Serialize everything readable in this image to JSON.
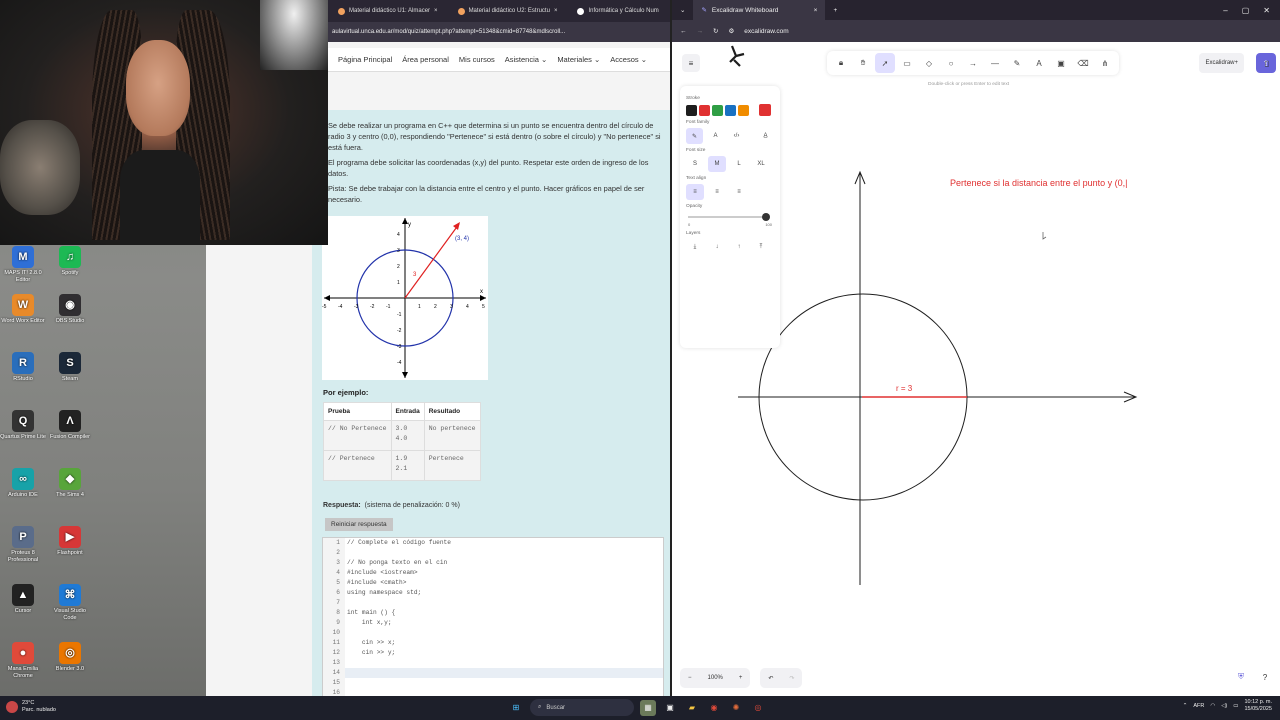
{
  "desktop": {
    "icons": [
      {
        "label": "MAPS IT! 2.8.0 Editor",
        "color": "#2f6fd6",
        "glyph": "M"
      },
      {
        "label": "Spotify",
        "color": "#1db954",
        "glyph": "♫"
      },
      {
        "label": "Word Worx Editor",
        "color": "#e88a2a",
        "glyph": "W"
      },
      {
        "label": "OBS Studio",
        "color": "#302e31",
        "glyph": "◉"
      },
      {
        "label": "RStudio",
        "color": "#2a6ebb",
        "glyph": "R"
      },
      {
        "label": "Steam",
        "color": "#1b2838",
        "glyph": "S"
      },
      {
        "label": "Quartus Prime Lite",
        "color": "#333333",
        "glyph": "Q"
      },
      {
        "label": "Fusion Compiler",
        "color": "#222222",
        "glyph": "Λ"
      },
      {
        "label": "Arduino IDE",
        "color": "#17a2a8",
        "glyph": "∞"
      },
      {
        "label": "The Sims 4",
        "color": "#58a53b",
        "glyph": "◆"
      },
      {
        "label": "Proteus 8 Professional",
        "color": "#5a6c8a",
        "glyph": "P"
      },
      {
        "label": "Flashpoint",
        "color": "#d63737",
        "glyph": "▶"
      },
      {
        "label": "Cursor",
        "color": "#222222",
        "glyph": "▲"
      },
      {
        "label": "Visual Studio Code",
        "color": "#1f7ad6",
        "glyph": "⌘"
      },
      {
        "label": "Mana Emilia Chrome",
        "color": "#e04a3a",
        "glyph": "●"
      },
      {
        "label": "Blender 3.0",
        "color": "#ea7600",
        "glyph": "◎"
      }
    ]
  },
  "left_browser": {
    "tabs": [
      "Material didáctico U1: Almacer",
      "Material didáctico U2: Estructu",
      "Informática y Cálculo Num"
    ],
    "url": "aulavirtual.unca.edu.ar/mod/quiz/attempt.php?attempt=51348&cmid=87748&mdlscroll...",
    "nav": [
      "Página Principal",
      "Área personal",
      "Mis cursos",
      "Asistencia ⌄",
      "Materiales ⌄",
      "Accesos ⌄"
    ],
    "desc": [
      "Se debe realizar un programa en C++ que determina si un punto se encuentra dentro del círculo de radio 3 y centro (0,0), respondiendo \"Pertenece\" si está dentro (o sobre el círculo) y \"No pertenece\" si está fuera.",
      "El programa debe solicitar las coordenadas (x,y) del punto. Respetar este orden de ingreso de los datos.",
      "Pista: Se debe trabajar con la distancia entre el centro y el punto. Hacer gráficos en papel de ser necesario."
    ],
    "plot": {
      "point_label": "(3, 4)",
      "radius_label": "3",
      "x_axis": "x",
      "y_axis": "y",
      "x_ticks": [
        "-5",
        "-4",
        "-3",
        "-2",
        "-1",
        "1",
        "2",
        "3",
        "4",
        "5"
      ],
      "y_ticks": [
        "4",
        "3",
        "2",
        "1",
        "-1",
        "-2",
        "-3",
        "-4"
      ]
    },
    "example_label": "Por ejemplo:",
    "table": {
      "headers": [
        "Prueba",
        "Entrada",
        "Resultado"
      ],
      "rows": [
        [
          "// No Pertenece",
          "3.0\n4.0",
          "No pertenece"
        ],
        [
          "// Pertenece",
          "1.9\n2.1",
          "Pertenece"
        ]
      ]
    },
    "respuesta_label": "Respuesta:",
    "respuesta_note": "(sistema de penalización: 0 %)",
    "reset_button": "Reiniciar respuesta",
    "code_lines": [
      "// Complete el código fuente",
      "",
      "// No ponga texto en el cin",
      "#include <iostream>",
      "#include <cmath>",
      "using namespace std;",
      "",
      "int main () {",
      "    int x,y;",
      "",
      "    cin >> x;",
      "    cin >> y;",
      "",
      "",
      "",
      ""
    ],
    "help": "?"
  },
  "right_browser": {
    "tab_title": "Excalidraw Whiteboard",
    "url": "excalidraw.com",
    "hint": "Double-click or press Enter to edit text",
    "library_label": "Excalidraw+",
    "panel": {
      "stroke_label": "Stroke",
      "stroke_colors": [
        "#1e1e1e",
        "#e03131",
        "#2f9e44",
        "#1971c2",
        "#f08c00"
      ],
      "current_color": "#e03131",
      "font_family_label": "Font family",
      "font_size_label": "Font size",
      "font_sizes": [
        "S",
        "M",
        "L",
        "XL"
      ],
      "text_align_label": "Text align",
      "opacity_label": "Opacity",
      "opacity_min": "0",
      "opacity_max": "100",
      "opacity_value": 100,
      "layers_label": "Layers"
    },
    "canvas_text": "Pertenece si la distancia entre el punto y (0,|",
    "radius_text": "r = 3",
    "zoom": "100%"
  },
  "taskbar": {
    "weather_temp": "23°C",
    "weather_desc": "Parc. nublado",
    "search": "Buscar",
    "lang": "AFR",
    "time": "10:12 p. m.",
    "date": "15/05/2025"
  }
}
